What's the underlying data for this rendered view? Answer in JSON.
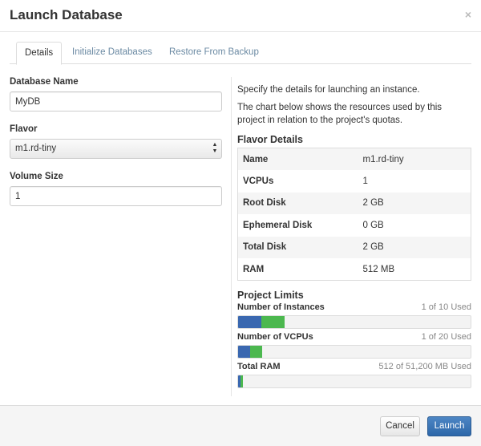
{
  "dialog": {
    "title": "Launch Database",
    "close_symbol": "×"
  },
  "tabs": [
    {
      "label": "Details",
      "active": true
    },
    {
      "label": "Initialize Databases",
      "active": false
    },
    {
      "label": "Restore From Backup",
      "active": false
    }
  ],
  "form": {
    "database_name": {
      "label": "Database Name",
      "value": "MyDB"
    },
    "flavor": {
      "label": "Flavor",
      "selected": "m1.rd-tiny"
    },
    "volume_size": {
      "label": "Volume Size",
      "value": "1"
    }
  },
  "info": {
    "description_1": "Specify the details for launching an instance.",
    "description_2": "The chart below shows the resources used by this project in relation to the project's quotas.",
    "flavor_details_heading": "Flavor Details",
    "flavor_details": [
      {
        "key": "Name",
        "value": "m1.rd-tiny"
      },
      {
        "key": "VCPUs",
        "value": "1"
      },
      {
        "key": "Root Disk",
        "value": "2 GB"
      },
      {
        "key": "Ephemeral Disk",
        "value": "0 GB"
      },
      {
        "key": "Total Disk",
        "value": "2 GB"
      },
      {
        "key": "RAM",
        "value": "512 MB"
      }
    ]
  },
  "project_limits": {
    "heading": "Project Limits",
    "items": [
      {
        "label": "Number of Instances",
        "used_text": "1 of 10 Used",
        "used_fraction": 0.1,
        "added_fraction": 0.1
      },
      {
        "label": "Number of VCPUs",
        "used_text": "1 of 20 Used",
        "used_fraction": 0.05,
        "added_fraction": 0.05
      },
      {
        "label": "Total RAM",
        "used_text": "512 of 51,200 MB Used",
        "used_fraction": 0.01,
        "added_fraction": 0.01
      }
    ],
    "colors": {
      "used": "#3a68b0",
      "added": "#4cb84f"
    }
  },
  "footer": {
    "cancel_label": "Cancel",
    "launch_label": "Launch"
  }
}
